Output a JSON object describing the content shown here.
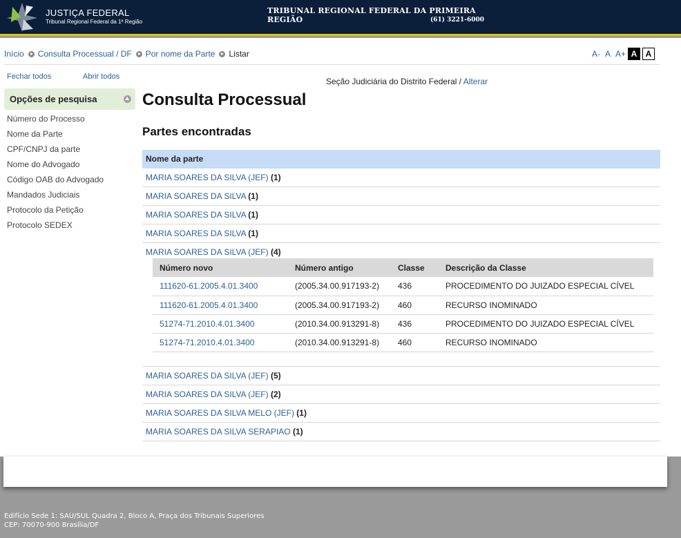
{
  "header": {
    "logo_title": "JUSTIÇA FEDERAL",
    "logo_subtitle": "Tribunal Regional Federal da 1ª Região",
    "court_name": "TRIBUNAL REGIONAL FEDERAL DA PRIMEIRA REGIÃO",
    "court_phone": "(61) 3221-6000"
  },
  "breadcrumb": {
    "items": [
      "Início",
      "Consulta Processual / DF",
      "Por nome da Parte"
    ],
    "current": "Listar"
  },
  "font_controls": {
    "decrease": "A-",
    "normal": "A",
    "increase": "A+",
    "contrast_dark": "A",
    "contrast_light": "A"
  },
  "sidebar": {
    "close_all": "Fechar todos",
    "open_all": "Abrir todos",
    "section_title": "Opções de pesquisa",
    "items": [
      "Número do Processo",
      "Nome da Parte",
      "CPF/CNPJ da parte",
      "Nome do Advogado",
      "Código OAB do Advogado",
      "Mandados Judiciais",
      "Protocolo da Petição",
      "Protocolo SEDEX"
    ]
  },
  "content": {
    "section_label": "Seção Judiciária do Distrito Federal",
    "section_sep": "/",
    "section_change": "Alterar",
    "title": "Consulta Processual",
    "subtitle": "Partes encontradas",
    "parts_header": "Nome da parte",
    "parties": [
      {
        "name": "MARIA SOARES DA SILVA (JEF)",
        "count": "(1)"
      },
      {
        "name": "MARIA SOARES DA SILVA",
        "count": "(1)"
      },
      {
        "name": "MARIA SOARES DA SILVA",
        "count": "(1)"
      },
      {
        "name": "MARIA SOARES DA SILVA",
        "count": "(1)"
      },
      {
        "name": "MARIA SOARES DA SILVA (JEF)",
        "count": "(4)"
      },
      {
        "name": "MARIA SOARES DA SILVA (JEF)",
        "count": "(5)"
      },
      {
        "name": "MARIA SOARES DA SILVA (JEF)",
        "count": "(2)"
      },
      {
        "name": "MARIA SOARES DA SILVA MELO (JEF)",
        "count": "(1)"
      },
      {
        "name": "MARIA SOARES DA SILVA SERAPIAO",
        "count": "(1)"
      }
    ],
    "process_table": {
      "headers": [
        "Número novo",
        "Número antigo",
        "Classe",
        "Descrição da Classe"
      ],
      "rows": [
        [
          "111620-61.2005.4.01.3400",
          "(2005.34.00.917193-2)",
          "436",
          "PROCEDIMENTO DO JUIZADO ESPECIAL CÍVEL"
        ],
        [
          "111620-61.2005.4.01.3400",
          "(2005.34.00.917193-2)",
          "460",
          "RECURSO INOMINADO"
        ],
        [
          "51274-71.2010.4.01.3400",
          "(2010.34.00.913291-8)",
          "436",
          "PROCEDIMENTO DO JUIZADO ESPECIAL CÍVEL"
        ],
        [
          "51274-71.2010.4.01.3400",
          "(2010.34.00.913291-8)",
          "460",
          "RECURSO INOMINADO"
        ]
      ]
    }
  },
  "footer": {
    "line1": "Edifício Sede 1: SAU/SUL Quadra 2, Bloco A, Praça dos Tribunais Superiores",
    "line2": "CEP: 70070-900 Brasília/DF"
  },
  "colors": {
    "header_bg": "#0b1f3b",
    "header_stripe": "#e3c300",
    "link": "#2a5f9a",
    "table_header": "#c6dcf7",
    "sidebar_header": "#e3eed8"
  }
}
